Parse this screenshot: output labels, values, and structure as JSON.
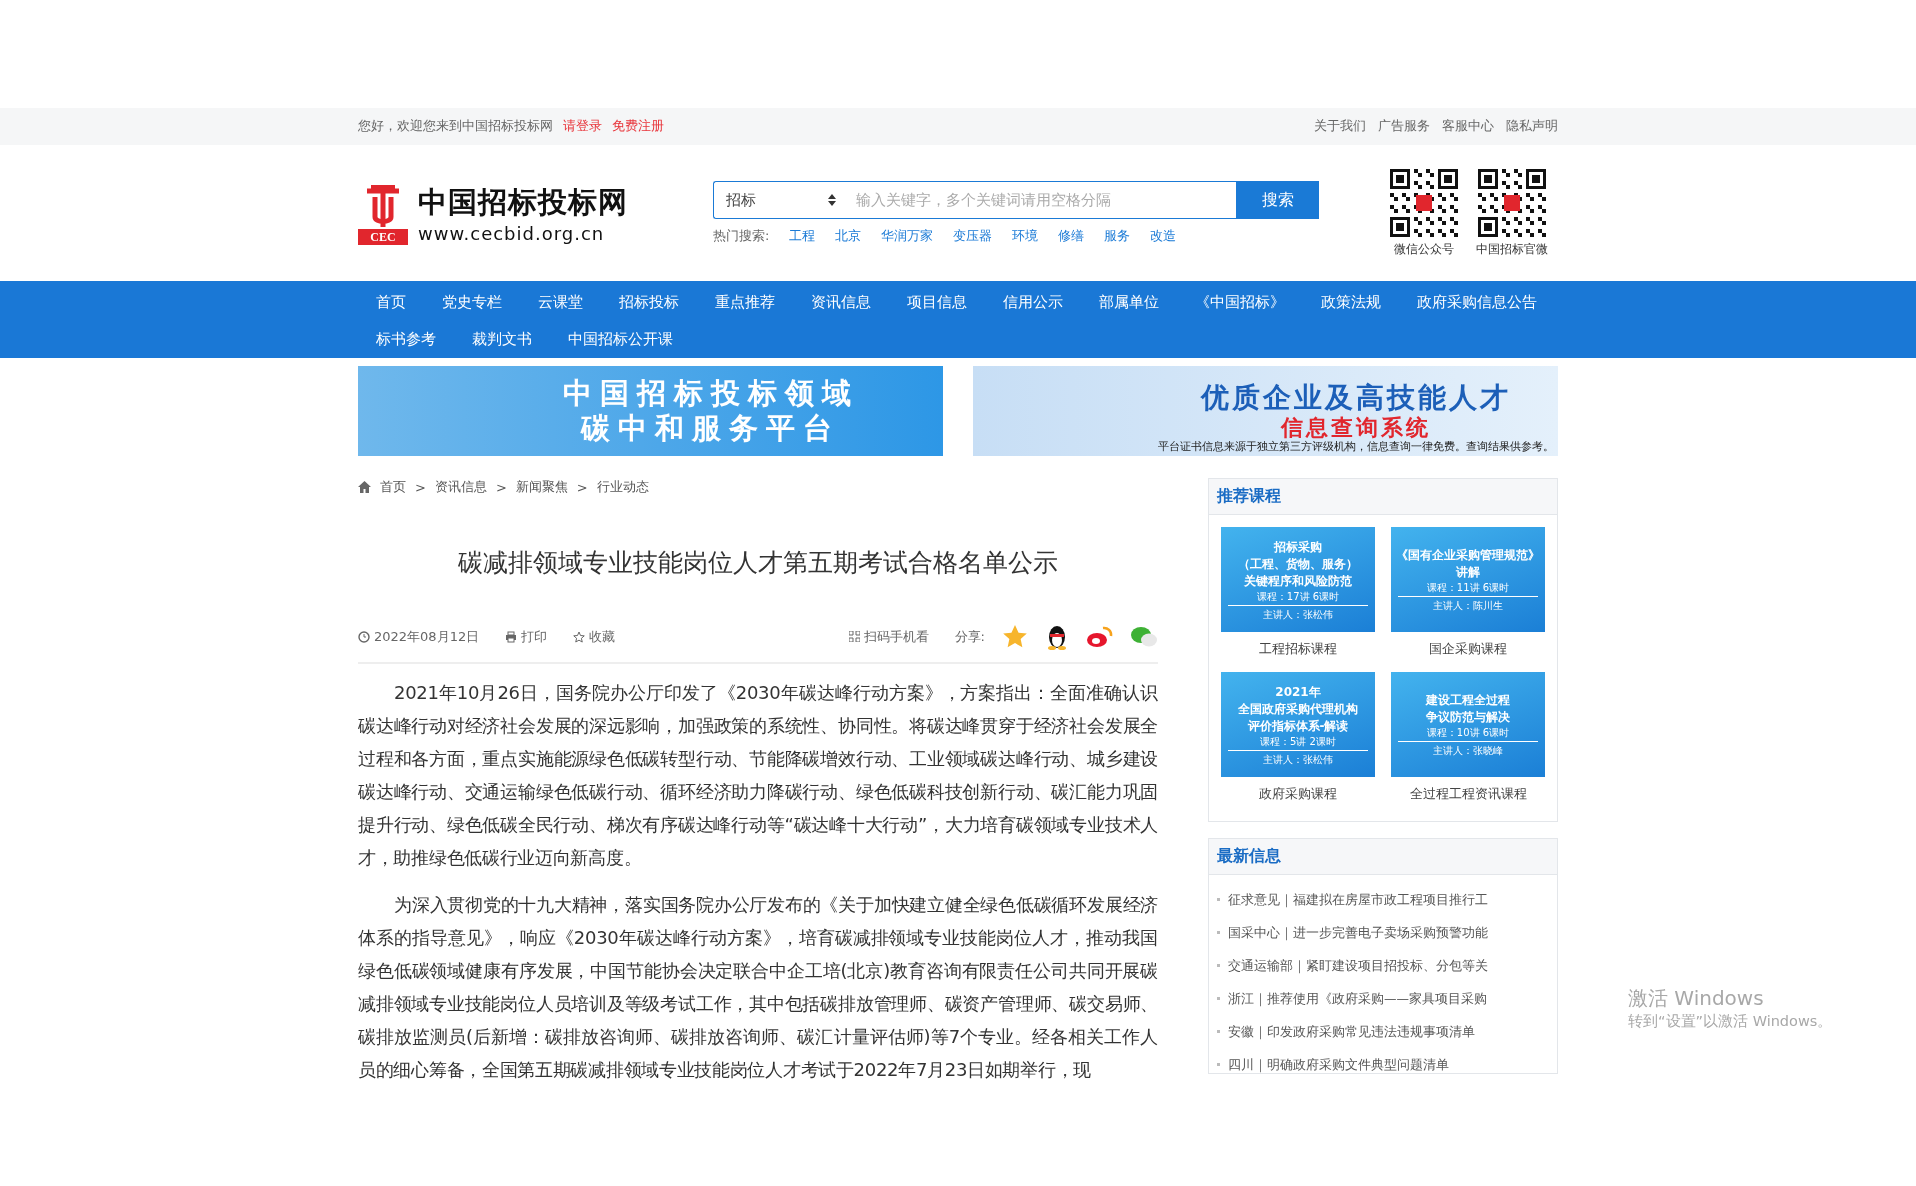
{
  "top_bar": {
    "greeting": "您好，欢迎您来到中国招标投标网",
    "login": "请登录",
    "register": "免费注册",
    "links": [
      "关于我们",
      "广告服务",
      "客服中心",
      "隐私声明"
    ]
  },
  "header": {
    "logo": {
      "mark": "CEC",
      "name": "中国招标投标网",
      "url": "www.cecbid.org.cn"
    },
    "search": {
      "category": "招标",
      "placeholder": "输入关键字，多个关键词请用空格分隔",
      "button": "搜索"
    },
    "hot_search": {
      "label": "热门搜索:",
      "terms": [
        "工程",
        "北京",
        "华润万家",
        "变压器",
        "环境",
        "修缮",
        "服务",
        "改造"
      ]
    },
    "qr_codes": [
      {
        "caption": "微信公众号"
      },
      {
        "caption": "中国招标官微"
      }
    ]
  },
  "nav": {
    "items": [
      "首页",
      "党史专栏",
      "云课堂",
      "招标投标",
      "重点推荐",
      "资讯信息",
      "项目信息",
      "信用公示",
      "部属单位",
      "《中国招标》",
      "政策法规",
      "政府采购信息公告",
      "标书参考",
      "裁判文书",
      "中国招标公开课"
    ]
  },
  "banners": [
    {
      "kind": "carbon",
      "lines": [
        "中国招标投标领域",
        "碳中和服务平台"
      ]
    },
    {
      "kind": "talent",
      "lines": [
        "优质企业及高技能人才",
        "信息查询系统"
      ],
      "note": "平台证书信息来源于独立第三方评级机构，信息查询一律免费。查询结果供参考。"
    }
  ],
  "breadcrumb": {
    "separator": ">",
    "items": [
      "首页",
      "资讯信息",
      "新闻聚焦",
      "行业动态"
    ]
  },
  "article": {
    "title": "碳减排领域专业技能岗位人才第五期考试合格名单公示",
    "date": "2022年08月12日",
    "actions": [
      {
        "kind": "print",
        "label": "打印"
      },
      {
        "kind": "favorite",
        "label": "收藏"
      }
    ],
    "mobile": "扫码手机看",
    "share": {
      "label": "分享:",
      "targets": [
        {
          "kind": "qzone"
        },
        {
          "kind": "qq"
        },
        {
          "kind": "weibo"
        },
        {
          "kind": "wechat"
        }
      ]
    },
    "paragraphs": [
      "2021年10月26日，国务院办公厅印发了《2030年碳达峰行动方案》，方案指出：全面准确认识碳达峰行动对经济社会发展的深远影响，加强政策的系统性、协同性。将碳达峰贯穿于经济社会发展全过程和各方面，重点实施能源绿色低碳转型行动、节能降碳增效行动、工业领域碳达峰行动、城乡建设碳达峰行动、交通运输绿色低碳行动、循环经济助力降碳行动、绿色低碳科技创新行动、碳汇能力巩固提升行动、绿色低碳全民行动、梯次有序碳达峰行动等“碳达峰十大行动”，大力培育碳领域专业技术人才，助推绿色低碳行业迈向新高度。",
      "为深入贯彻党的十九大精神，落实国务院办公厅发布的《关于加快建立健全绿色低碳循环发展经济体系的指导意见》，响应《2030年碳达峰行动方案》，培育碳减排领域专业技能岗位人才，推动我国绿色低碳领域健康有序发展，中国节能协会决定联合中企工培(北京)教育咨询有限责任公司共同开展碳减排领域专业技能岗位人员培训及等级考试工作，其中包括碳排放管理师、碳资产管理师、碳交易师、碳排放监测员(后新增：碳排放咨询师、碳排放咨询师、碳汇计量评估师)等7个专业。经各相关工作人员的细心筹备，全国第五期碳减排领域专业技能岗位人才考试于2022年7月23日如期举行，现"
    ]
  },
  "sidebar": {
    "courses": {
      "title": "推荐课程",
      "items": [
        {
          "lines": [
            "招标采购",
            "（工程、货物、服务）",
            "关键程序和风险防范"
          ],
          "meta": "课程：17讲 6课时",
          "lecturer": "主讲人：张松伟",
          "caption": "工程招标课程"
        },
        {
          "lines": [
            "《国有企业采购管理规范》",
            "讲解"
          ],
          "meta": "课程：11讲 6课时",
          "lecturer": "主讲人：陈川生",
          "caption": "国企采购课程"
        },
        {
          "lines": [
            "2021年",
            "全国政府采购代理机构",
            "评价指标体系-解读"
          ],
          "meta": "课程：5讲 2课时",
          "lecturer": "主讲人：张松伟",
          "caption": "政府采购课程"
        },
        {
          "lines": [
            "建设工程全过程",
            "争议防范与解决"
          ],
          "meta": "课程：10讲 6课时",
          "lecturer": "主讲人：张晓峰",
          "caption": "全过程工程资讯课程"
        }
      ]
    },
    "latest": {
      "title": "最新信息",
      "items": [
        "征求意见｜福建拟在房屋市政工程项目推行工",
        "国采中心｜进一步完善电子卖场采购预警功能",
        "交通运输部｜紧盯建设项目招投标、分包等关",
        "浙江｜推荐使用《政府采购——家具项目采购",
        "安徽｜印发政府采购常见违法违规事项清单",
        "四川｜明确政府采购文件典型问题清单"
      ]
    }
  },
  "os_watermark": {
    "title": "激活 Windows",
    "subtitle": "转到“设置”以激活 Windows。"
  }
}
